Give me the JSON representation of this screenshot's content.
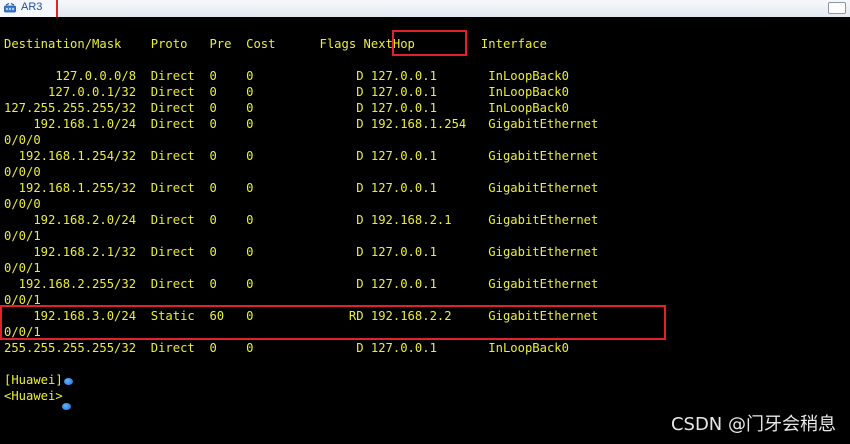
{
  "window": {
    "tab_title": "AR3"
  },
  "table": {
    "header": "Destination/Mask    Proto   Pre  Cost      Flags NextHop         Interface",
    "rows": [
      {
        "dest": "127.0.0.0/8",
        "proto": "Direct",
        "pre": "0",
        "cost": "0",
        "flags": "D",
        "nexthop": "127.0.0.1",
        "iface": "InLoopBack0",
        "wrap": ""
      },
      {
        "dest": "127.0.0.1/32",
        "proto": "Direct",
        "pre": "0",
        "cost": "0",
        "flags": "D",
        "nexthop": "127.0.0.1",
        "iface": "InLoopBack0",
        "wrap": ""
      },
      {
        "dest": "127.255.255.255/32",
        "proto": "Direct",
        "pre": "0",
        "cost": "0",
        "flags": "D",
        "nexthop": "127.0.0.1",
        "iface": "InLoopBack0",
        "wrap": ""
      },
      {
        "dest": "192.168.1.0/24",
        "proto": "Direct",
        "pre": "0",
        "cost": "0",
        "flags": "D",
        "nexthop": "192.168.1.254",
        "iface": "GigabitEthernet",
        "wrap": "0/0/0"
      },
      {
        "dest": "192.168.1.254/32",
        "proto": "Direct",
        "pre": "0",
        "cost": "0",
        "flags": "D",
        "nexthop": "127.0.0.1",
        "iface": "GigabitEthernet",
        "wrap": "0/0/0"
      },
      {
        "dest": "192.168.1.255/32",
        "proto": "Direct",
        "pre": "0",
        "cost": "0",
        "flags": "D",
        "nexthop": "127.0.0.1",
        "iface": "GigabitEthernet",
        "wrap": "0/0/0"
      },
      {
        "dest": "192.168.2.0/24",
        "proto": "Direct",
        "pre": "0",
        "cost": "0",
        "flags": "D",
        "nexthop": "192.168.2.1",
        "iface": "GigabitEthernet",
        "wrap": "0/0/1"
      },
      {
        "dest": "192.168.2.1/32",
        "proto": "Direct",
        "pre": "0",
        "cost": "0",
        "flags": "D",
        "nexthop": "127.0.0.1",
        "iface": "GigabitEthernet",
        "wrap": "0/0/1"
      },
      {
        "dest": "192.168.2.255/32",
        "proto": "Direct",
        "pre": "0",
        "cost": "0",
        "flags": "D",
        "nexthop": "127.0.0.1",
        "iface": "GigabitEthernet",
        "wrap": "0/0/1"
      },
      {
        "dest": "192.168.3.0/24",
        "proto": "Static",
        "pre": "60",
        "cost": "0",
        "flags": "RD",
        "nexthop": "192.168.2.2",
        "iface": "GigabitEthernet",
        "wrap": "0/0/1"
      },
      {
        "dest": "255.255.255.255/32",
        "proto": "Direct",
        "pre": "0",
        "cost": "0",
        "flags": "D",
        "nexthop": "127.0.0.1",
        "iface": "InLoopBack0",
        "wrap": ""
      }
    ]
  },
  "prompts": [
    "[Huawei]",
    "<Huawei>"
  ],
  "watermark": "CSDN @门牙会稍息",
  "colors": {
    "terminal_bg": "#000000",
    "terminal_text": "#ecec40",
    "highlight": "#e0222a"
  }
}
